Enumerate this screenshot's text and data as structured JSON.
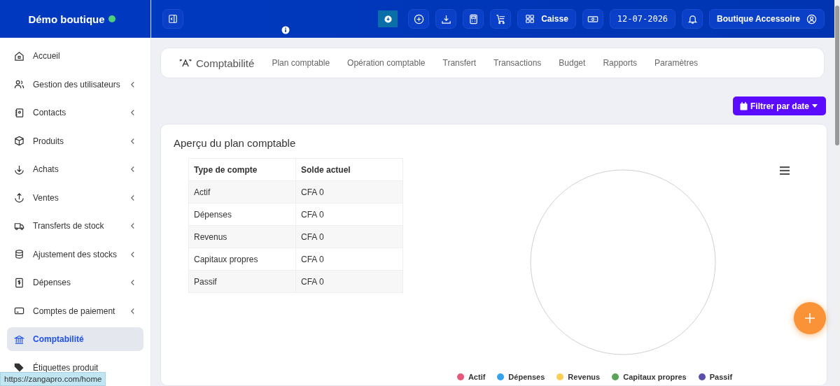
{
  "brand": {
    "name": "Démo boutique",
    "online": true
  },
  "header": {
    "buttons": [
      {
        "kind": "update"
      },
      {
        "kind": "add"
      },
      {
        "kind": "download"
      },
      {
        "kind": "calculator"
      },
      {
        "kind": "cart"
      },
      {
        "kind": "pos",
        "label": "Caisse"
      },
      {
        "kind": "cash"
      },
      {
        "kind": "date",
        "label": "12-07-2026"
      },
      {
        "kind": "bell"
      },
      {
        "kind": "user",
        "label": "Boutique Accessoire"
      }
    ]
  },
  "sidebar": {
    "items": [
      {
        "kind": "home",
        "label": "Accueil",
        "expandable": false,
        "selected": false
      },
      {
        "kind": "users",
        "label": "Gestion des utilisateurs",
        "expandable": true,
        "selected": false
      },
      {
        "kind": "contacts",
        "label": "Contacts",
        "expandable": true,
        "selected": false
      },
      {
        "kind": "box",
        "label": "Produits",
        "expandable": true,
        "selected": false
      },
      {
        "kind": "down",
        "label": "Achats",
        "expandable": true,
        "selected": false
      },
      {
        "kind": "up",
        "label": "Ventes",
        "expandable": true,
        "selected": false
      },
      {
        "kind": "truck",
        "label": "Transferts de stock",
        "expandable": true,
        "selected": false
      },
      {
        "kind": "database",
        "label": "Ajustement des stocks",
        "expandable": true,
        "selected": false
      },
      {
        "kind": "receipt",
        "label": "Dépenses",
        "expandable": true,
        "selected": false
      },
      {
        "kind": "card",
        "label": "Comptes de paiement",
        "expandable": true,
        "selected": false
      },
      {
        "kind": "bank",
        "label": "Comptabilité",
        "expandable": false,
        "selected": true
      },
      {
        "kind": "tags",
        "label": "Étiquettes produit",
        "expandable": false,
        "selected": false
      }
    ]
  },
  "status_url": "https://zangapro.com/home",
  "subnav": {
    "title": "Comptabilité",
    "tabs": [
      {
        "label": "Plan comptable"
      },
      {
        "label": "Opération comptable"
      },
      {
        "label": "Transfert"
      },
      {
        "label": "Transactions"
      },
      {
        "label": "Budget"
      },
      {
        "label": "Rapports"
      },
      {
        "label": "Paramètres"
      }
    ]
  },
  "filter_button": "Filtrer par date",
  "card": {
    "title": "Aperçu du plan comptable",
    "table": {
      "columns": [
        "Type de compte",
        "Solde actuel"
      ],
      "rows": [
        [
          "Actif",
          "CFA 0"
        ],
        [
          "Dépenses",
          "CFA 0"
        ],
        [
          "Revenus",
          "CFA 0"
        ],
        [
          "Capitaux propres",
          "CFA 0"
        ],
        [
          "Passif",
          "CFA 0"
        ]
      ]
    },
    "legend": [
      {
        "label": "Actif",
        "color": "#e8587a"
      },
      {
        "label": "Dépenses",
        "color": "#36a2eb"
      },
      {
        "label": "Revenus",
        "color": "#ffcd56"
      },
      {
        "label": "Capitaux propres",
        "color": "#5aa45a"
      },
      {
        "label": "Passif",
        "color": "#5b4fa8"
      }
    ]
  }
}
